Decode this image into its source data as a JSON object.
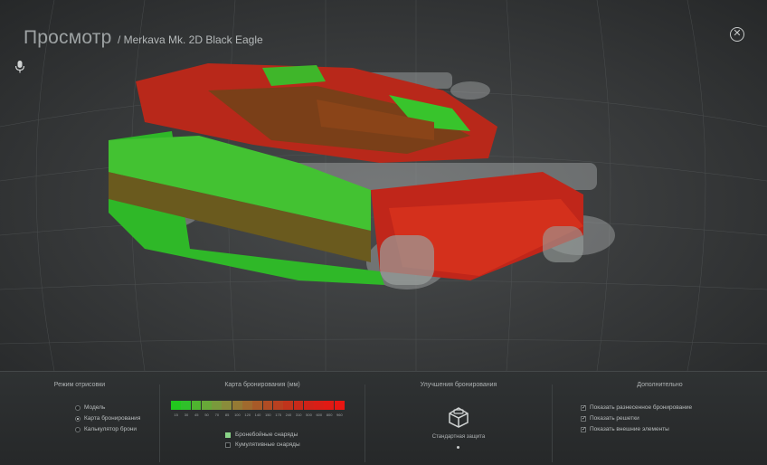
{
  "header": {
    "title": "Просмотр",
    "vehicle": "/ Merkava Mk. 2D Black Eagle",
    "close_icon": "close-icon",
    "mic_icon": "microphone-icon"
  },
  "render_mode": {
    "title": "Режим отрисовки",
    "options": [
      {
        "label": "Модель",
        "selected": false
      },
      {
        "label": "Карта бронирования",
        "selected": true
      },
      {
        "label": "Калькулятор брони",
        "selected": false
      }
    ]
  },
  "armor_map": {
    "title": "Карта бронирования (мм)",
    "scale_values": [
      "15",
      "30",
      "45",
      "50",
      "70",
      "85",
      "100",
      "120",
      "140",
      "150",
      "175",
      "240",
      "310",
      "500",
      "600",
      "800",
      "960"
    ],
    "scale_colors": [
      "#22c81e",
      "#2fc12a",
      "#4fb52f",
      "#68a838",
      "#7a9a3c",
      "#8a8c3b",
      "#957a34",
      "#a06a2e",
      "#a85a28",
      "#b04c24",
      "#b84020",
      "#c0341c",
      "#c82a1a",
      "#d02218",
      "#d81e16",
      "#e01a14",
      "#e81612"
    ],
    "legend": [
      {
        "label": "Бронебойные снаряды",
        "color": "#8ad488"
      },
      {
        "label": "Кумулятивные снаряды",
        "color": "#1b1d1e"
      }
    ]
  },
  "armor_upgrades": {
    "title": "Улучшения бронирования",
    "item_label": "Стандартная защита",
    "item_icon": "armor-box-icon"
  },
  "extra": {
    "title": "Дополнительно",
    "options": [
      {
        "label": "Показать разнесенное бронирование",
        "checked": true
      },
      {
        "label": "Показать решетки",
        "checked": true
      },
      {
        "label": "Показать внешние элементы",
        "checked": true
      }
    ]
  }
}
